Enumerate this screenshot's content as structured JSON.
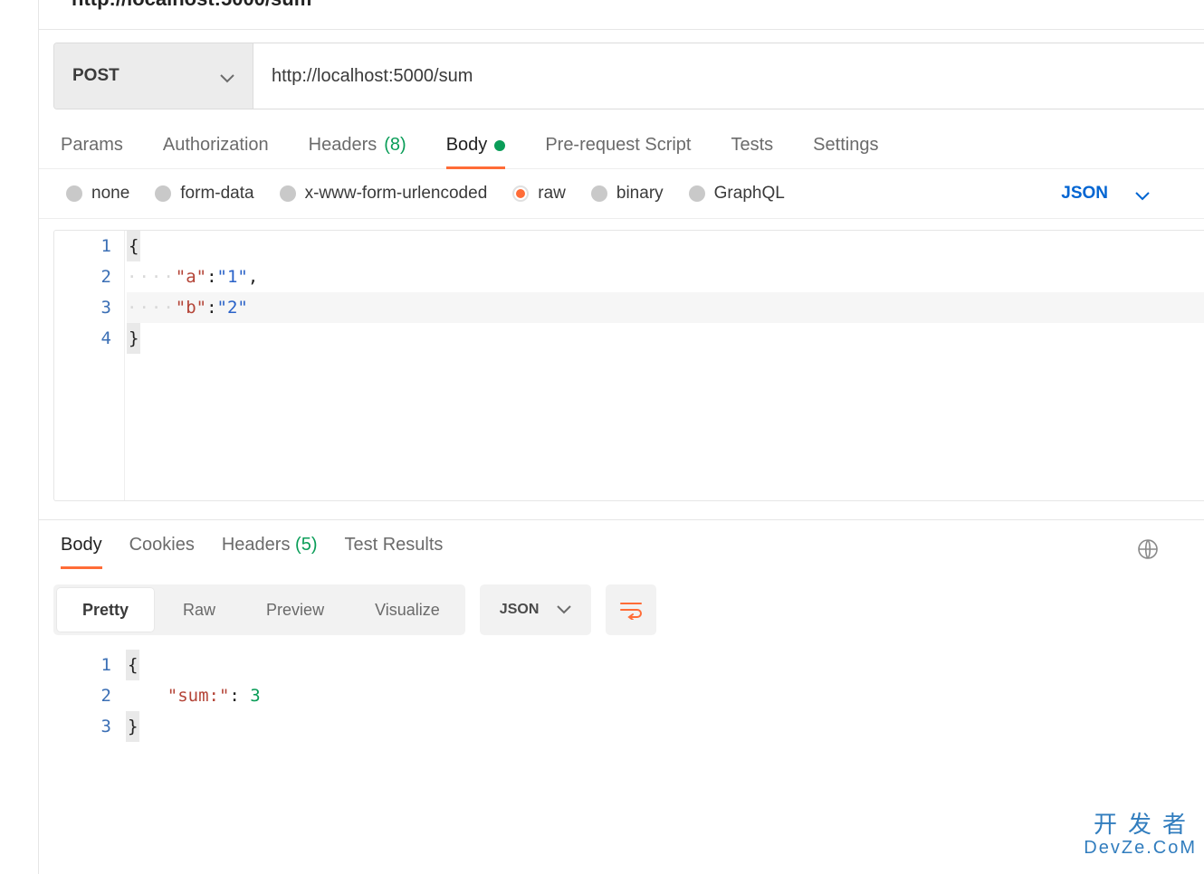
{
  "page_title_truncated": "http://localhost:5000/sum",
  "request": {
    "method": "POST",
    "url": "http://localhost:5000/sum"
  },
  "request_tabs": {
    "params": "Params",
    "authorization": "Authorization",
    "headers_label": "Headers",
    "headers_count": "(8)",
    "body": "Body",
    "prerequest": "Pre-request Script",
    "tests": "Tests",
    "settings": "Settings"
  },
  "body_types": {
    "none": "none",
    "formdata": "form-data",
    "urlencoded": "x-www-form-urlencoded",
    "raw": "raw",
    "binary": "binary",
    "graphql": "GraphQL",
    "format_label": "JSON"
  },
  "request_body": {
    "lines": {
      "l1": "1",
      "l2": "2",
      "l3": "3",
      "l4": "4",
      "key_a": "\"a\"",
      "val_a": "\"1\"",
      "comma": ",",
      "key_b": "\"b\"",
      "val_b": "\"2\"",
      "colon": ":",
      "lbrace": "{",
      "rbrace": "}"
    }
  },
  "response_tabs": {
    "body": "Body",
    "cookies": "Cookies",
    "headers_label": "Headers",
    "headers_count": "(5)",
    "test_results": "Test Results"
  },
  "response_views": {
    "pretty": "Pretty",
    "raw": "Raw",
    "preview": "Preview",
    "visualize": "Visualize",
    "format_label": "JSON"
  },
  "response_body": {
    "lines": {
      "l1": "1",
      "l2": "2",
      "l3": "3",
      "key_sum": "\"sum:\"",
      "sep": ": ",
      "val_sum": "3",
      "lbrace": "{",
      "rbrace": "}"
    }
  },
  "watermark": {
    "line1": "开发者",
    "line2": "DevZe.CoM"
  }
}
